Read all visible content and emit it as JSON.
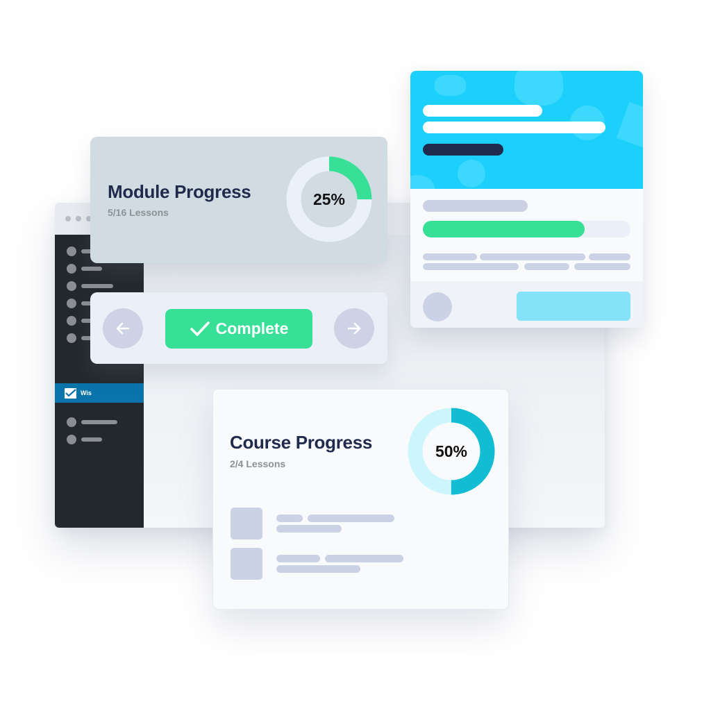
{
  "browser": {
    "window_controls": [
      "dot",
      "dot",
      "dot"
    ],
    "sidebar": {
      "active_item_label": "Wis",
      "active_item_icon": "checkbox-icon",
      "colors": {
        "background": "#23282d",
        "active": "#0a73aa",
        "placeholder": "#8b8e93"
      }
    }
  },
  "module_progress": {
    "title": "Module Progress",
    "subtitle": "5/16 Lessons",
    "percent_label": "25%",
    "percent": 25,
    "colors": {
      "fill": "#38e097",
      "track": "#eaf1f8",
      "card": "#d1dce2"
    }
  },
  "lesson_nav": {
    "prev_icon": "arrow-left-icon",
    "next_icon": "arrow-right-icon",
    "complete_label": "Complete",
    "complete_icon": "checkmark-icon",
    "colors": {
      "complete": "#38e097",
      "nav_button": "#cdd3e4"
    }
  },
  "course_card": {
    "progress_percent": 78,
    "colors": {
      "hero": "#1cd0fb",
      "progress": "#38e097",
      "track": "#ebeff8",
      "cta": "#84e2f9",
      "title_pill": "#1f2a4c"
    }
  },
  "course_progress": {
    "title": "Course Progress",
    "subtitle": "2/4 Lessons",
    "percent_label": "50%",
    "percent": 50,
    "lesson_count_shown": 2,
    "colors": {
      "fill": "#12bcd2",
      "track": "#cdf6fc"
    }
  }
}
